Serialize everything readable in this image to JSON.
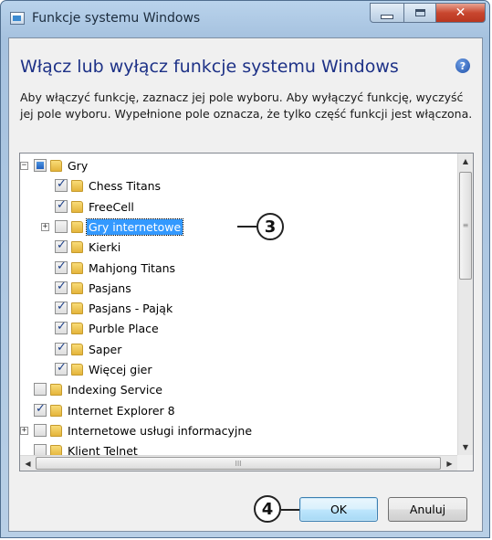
{
  "window": {
    "title": "Funkcje systemu Windows"
  },
  "heading": "Włącz lub wyłącz funkcje systemu Windows",
  "description": "Aby włączyć funkcję, zaznacz jej pole wyboru. Aby wyłączyć funkcję, wyczyść jej pole wyboru. Wypełnione pole oznacza, że tylko część funkcji jest włączona.",
  "tree": {
    "items": [
      {
        "label": "Gry",
        "state": "partial",
        "expander": "−",
        "selected": false
      },
      {
        "label": "Chess Titans",
        "state": "checked",
        "expander": "",
        "selected": false
      },
      {
        "label": "FreeCell",
        "state": "checked",
        "expander": "",
        "selected": false
      },
      {
        "label": "Gry internetowe",
        "state": "unchecked",
        "expander": "+",
        "selected": true
      },
      {
        "label": "Kierki",
        "state": "checked",
        "expander": "",
        "selected": false
      },
      {
        "label": "Mahjong Titans",
        "state": "checked",
        "expander": "",
        "selected": false
      },
      {
        "label": "Pasjans",
        "state": "checked",
        "expander": "",
        "selected": false
      },
      {
        "label": "Pasjans - Pająk",
        "state": "checked",
        "expander": "",
        "selected": false
      },
      {
        "label": "Purble Place",
        "state": "checked",
        "expander": "",
        "selected": false
      },
      {
        "label": "Saper",
        "state": "checked",
        "expander": "",
        "selected": false
      },
      {
        "label": "Więcej gier",
        "state": "checked",
        "expander": "",
        "selected": false
      },
      {
        "label": "Indexing Service",
        "state": "unchecked",
        "expander": "",
        "selected": false
      },
      {
        "label": "Internet Explorer 8",
        "state": "checked",
        "expander": "",
        "selected": false
      },
      {
        "label": "Internetowe usługi informacyjne",
        "state": "unchecked",
        "expander": "+",
        "selected": false
      },
      {
        "label": "Klient Telnet",
        "state": "unchecked",
        "expander": "",
        "selected": false
      }
    ],
    "hscroll_grip": "III"
  },
  "callouts": {
    "step3": "3",
    "step4": "4"
  },
  "buttons": {
    "ok": "OK",
    "cancel": "Anuluj"
  },
  "icons": {
    "app": "window-features-icon",
    "help": "help-icon",
    "folder": "folder-icon"
  },
  "colors": {
    "heading": "#1e3287",
    "selection": "#3399ff",
    "close_button": "#c9472f"
  }
}
